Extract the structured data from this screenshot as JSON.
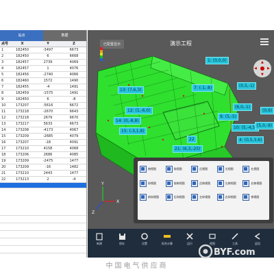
{
  "table": {
    "tabs": [
      {
        "label": "站点",
        "active": true
      },
      {
        "label": "数据",
        "active": false
      }
    ],
    "headers": [
      "点号",
      "X",
      "Y",
      "Z"
    ],
    "rows": [
      [
        "1",
        "182450",
        "-3497",
        "6673"
      ],
      [
        "2",
        "182450",
        "6",
        "6668"
      ],
      [
        "3",
        "182457",
        "2739",
        "4069"
      ],
      [
        "4",
        "182457",
        "1",
        "4076"
      ],
      [
        "5",
        "182456",
        "-2740",
        "4066"
      ],
      [
        "6",
        "182460",
        "1572",
        "1490"
      ],
      [
        "7",
        "182455",
        "-4",
        "1491"
      ],
      [
        "8",
        "182459",
        "-1575",
        "1491"
      ],
      [
        "9",
        "182450",
        "6",
        "-8"
      ],
      [
        "10",
        "173207",
        "-5616",
        "6672"
      ],
      [
        "11",
        "173218",
        "-2670",
        "6643"
      ],
      [
        "12",
        "173218",
        "2679",
        "6670"
      ],
      [
        "13",
        "173217",
        "5633",
        "6673"
      ],
      [
        "14",
        "173208",
        "-4173",
        "4067"
      ],
      [
        "15",
        "173209",
        "-2685",
        "4079"
      ],
      [
        "16",
        "173207",
        "-18",
        "4091"
      ],
      [
        "17",
        "173210",
        "4158",
        "4068"
      ],
      [
        "18",
        "173206",
        "2686",
        "4085"
      ],
      [
        "19",
        "173209",
        "-2475",
        "1477"
      ],
      [
        "20",
        "173209",
        "-16",
        "1482"
      ],
      [
        "21",
        "173210",
        "2443",
        "1477"
      ],
      [
        "22",
        "173213",
        "2",
        "-4"
      ]
    ]
  },
  "view": {
    "status_button": "已配置显示",
    "title": "演示工程",
    "colors": {
      "mesh": "#2fe02f",
      "background": "#595959",
      "label_bg": "#28c6dc",
      "toolbar_bg": "#1f2d3d",
      "selection": "#1e6fe0"
    },
    "point_labels": [
      {
        "text": "1: (0,0,0)"
      },
      {
        "text": "13: (7,6,3)"
      },
      {
        "text": "7: (-1,-8)"
      },
      {
        "text": "(0,5,-1)"
      },
      {
        "text": "12: (1,-6,0)"
      },
      {
        "text": "14: (0,-8,8)"
      },
      {
        "text": "15: (-3,1,8)"
      },
      {
        "text": "(6,0,-1)"
      },
      {
        "text": "9: (5,-5)"
      },
      {
        "text": "10: (5,-4,5)"
      },
      {
        "text": "(5,0,-9)"
      },
      {
        "text": "21: (6,3,-25)"
      },
      {
        "text": "4: (0,5,3,6)"
      },
      {
        "text": "(0,6)"
      },
      {
        "text": "22"
      }
    ],
    "axes": [
      "Y",
      "X",
      "Z"
    ]
  },
  "popup": {
    "options": [
      {
        "label": "俯视图",
        "icon": "view-cube-icon"
      },
      {
        "label": "前视图",
        "icon": "view-cube-icon"
      },
      {
        "label": "后视图",
        "icon": "view-cube-icon"
      },
      {
        "label": "左视图",
        "icon": "view-cube-icon"
      },
      {
        "label": "右视图",
        "icon": "view-cube-icon"
      },
      {
        "label": "仰视图",
        "icon": "view-cube-icon"
      },
      {
        "label": "前俯视图",
        "icon": "view-cube-icon"
      },
      {
        "label": "后俯视图",
        "icon": "view-cube-icon"
      },
      {
        "label": "左俯视图",
        "icon": "view-cube-icon"
      },
      {
        "label": "右俯视图",
        "icon": "view-cube-icon"
      },
      {
        "label": "前仰视图",
        "icon": "view-cube-icon"
      },
      {
        "label": "后仰视图",
        "icon": "view-cube-icon"
      },
      {
        "label": "左仰视图",
        "icon": "view-cube-icon"
      },
      {
        "label": "右仰视图",
        "icon": "view-cube-icon"
      },
      {
        "label": "侧视图",
        "icon": "view-cube-icon"
      }
    ]
  },
  "toolbar": {
    "items": [
      {
        "label": "新建",
        "icon": "new-icon"
      },
      {
        "label": "保存",
        "icon": "save-icon"
      },
      {
        "label": "设置",
        "icon": "settings-icon"
      },
      {
        "label": "拟合计算",
        "icon": "fit-icon"
      },
      {
        "label": "运行",
        "icon": "run-icon"
      },
      {
        "label": "视图",
        "icon": "view-icon"
      },
      {
        "label": "工具",
        "icon": "tool-icon"
      },
      {
        "label": "返回",
        "icon": "back-icon"
      }
    ]
  },
  "watermark": "BYF.com",
  "footer": "中国电气供应商"
}
